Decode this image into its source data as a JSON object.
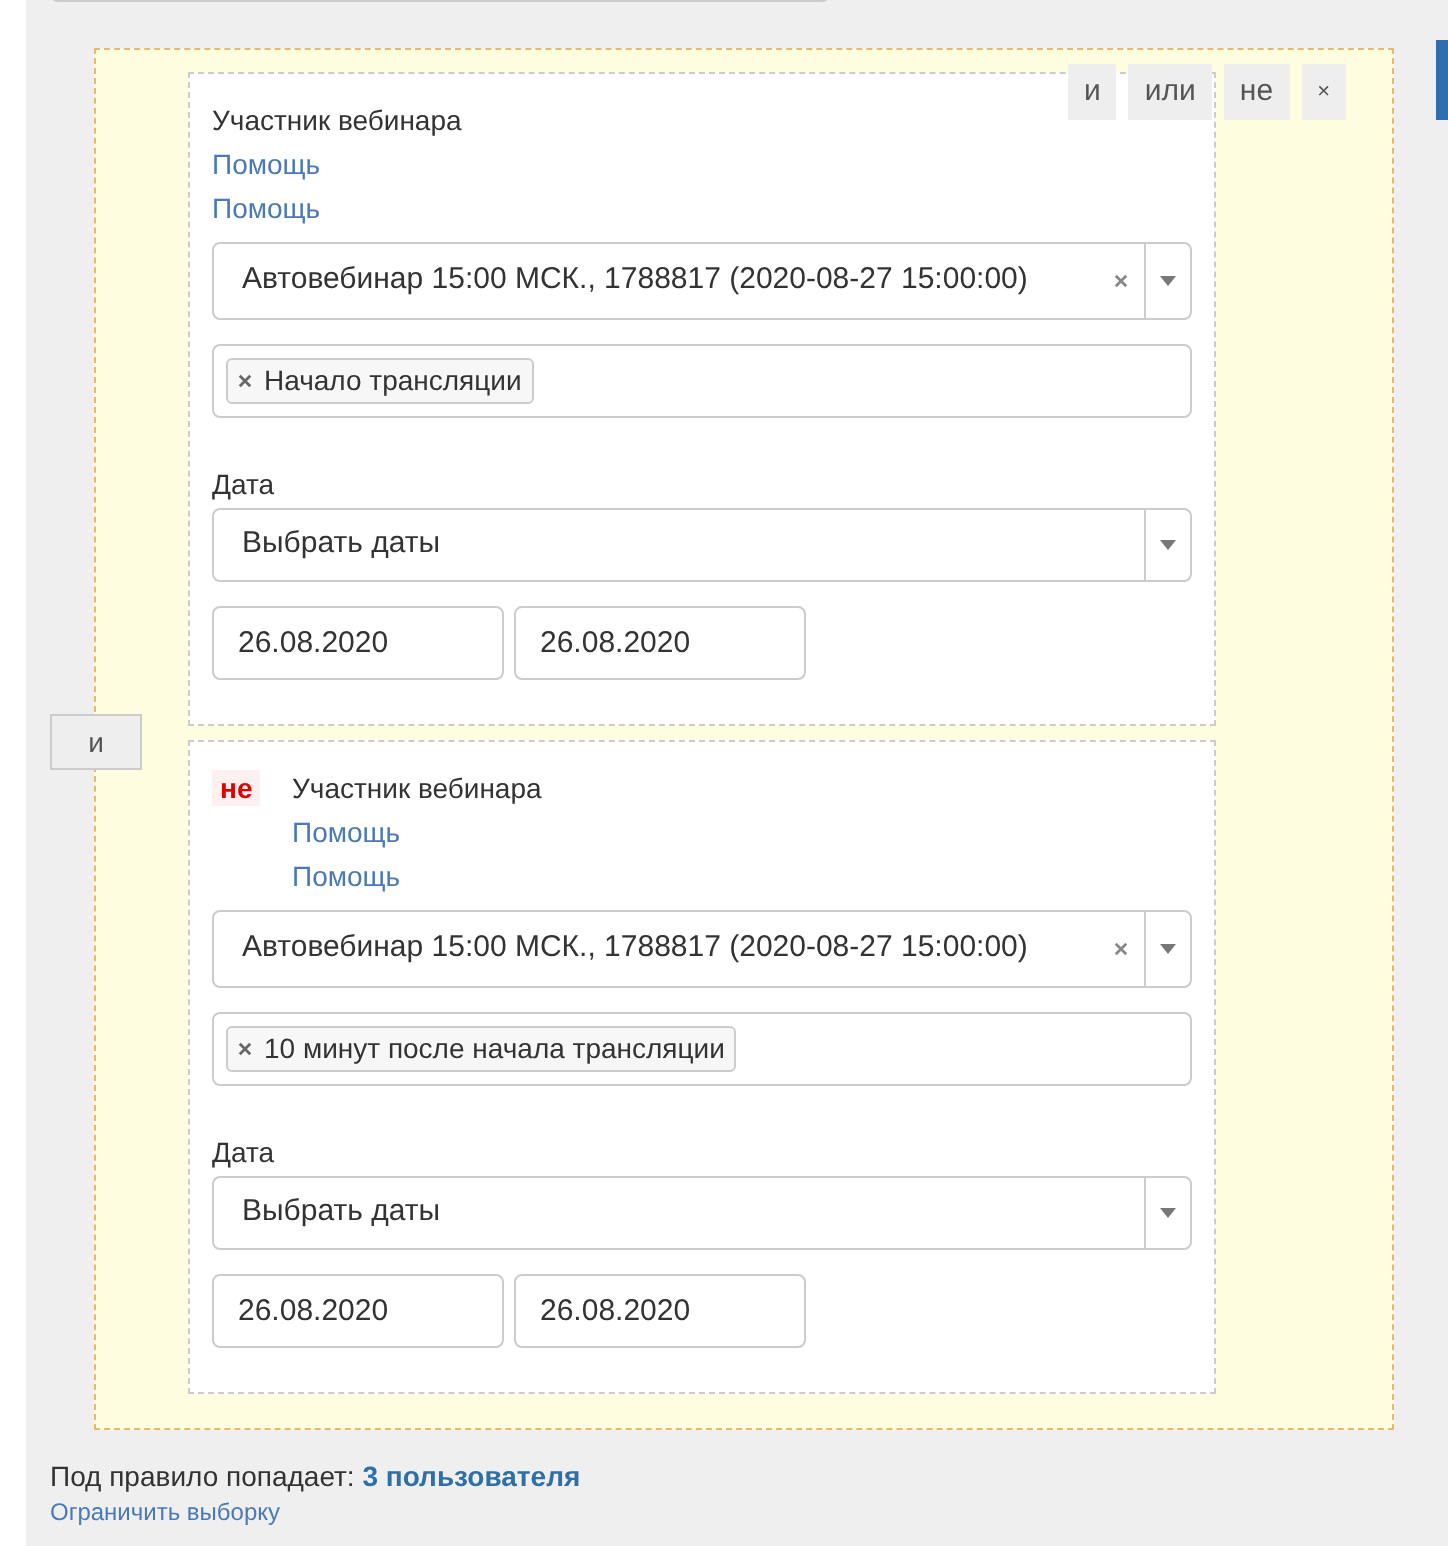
{
  "group_buttons": [
    {
      "label": "и",
      "kind": "text"
    },
    {
      "label": "или",
      "kind": "text"
    },
    {
      "label": "не",
      "kind": "text"
    },
    {
      "label": "×",
      "kind": "close"
    }
  ],
  "join_button": "и",
  "conditions": [
    {
      "negated": false,
      "title": "Участник вебинара",
      "links": [
        "Помощь",
        "Помощь"
      ],
      "webinar": "Автовебинар 15:00 МСК., 1788817 (2020-08-27 15:00:00)",
      "tags": [
        "Начало трансляции"
      ],
      "date_label": "Дата",
      "date_select": "Выбрать даты",
      "date_from": "26.08.2020",
      "date_to": "26.08.2020"
    },
    {
      "negated": true,
      "negation_label": "не",
      "title": "Участник вебинара",
      "links": [
        "Помощь",
        "Помощь"
      ],
      "webinar": "Автовебинар 15:00 МСК., 1788817 (2020-08-27 15:00:00)",
      "tags": [
        "10 минут после начала трансляции"
      ],
      "date_label": "Дата",
      "date_select": "Выбрать даты",
      "date_from": "26.08.2020",
      "date_to": "26.08.2020"
    }
  ],
  "result": {
    "prefix": "Под правило попадает:",
    "count": "3 пользователя"
  },
  "limit_link": "Ограничить выборку"
}
